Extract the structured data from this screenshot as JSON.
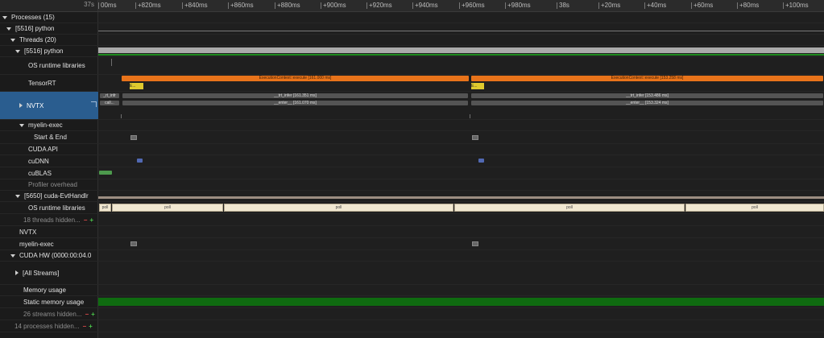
{
  "ruler": {
    "corner": "37s",
    "ticks": [
      "00ms",
      "+820ms",
      "+840ms",
      "+860ms",
      "+880ms",
      "+900ms",
      "+920ms",
      "+940ms",
      "+960ms",
      "+980ms",
      "38s",
      "+20ms",
      "+40ms",
      "+60ms",
      "+80ms",
      "+100ms"
    ]
  },
  "rows": {
    "processes": "Processes (15)",
    "python_proc": "[5516] python",
    "threads": "Threads (20)",
    "python_thread": "[5516] python",
    "os_runtime": "OS runtime libraries",
    "tensorrt": "TensorRT",
    "nvtx": "NVTX",
    "myelin_exec": "myelin-exec",
    "start_end": "Start & End",
    "cuda_api": "CUDA API",
    "cudnn": "cuDNN",
    "cublas": "cuBLAS",
    "profiler_overhead": "Profiler overhead",
    "evthandler": "[5650] cuda-EvtHandlr",
    "os_runtime_2": "OS runtime libraries",
    "threads_hidden": "18 threads hidden...",
    "nvtx_2": "NVTX",
    "myelin_exec_2": "myelin-exec",
    "cuda_hw": "CUDA HW (0000:00:04.0",
    "all_streams": "[All Streams]",
    "memory_usage": "Memory usage",
    "static_memory": "Static memory usage",
    "streams_hidden": "26 streams hidden...",
    "processes_hidden": "14 processes hidden..."
  },
  "controls": {
    "minus": "−",
    "plus": "+"
  },
  "events": {
    "exec1": "ExecutionContext::execute [161.000 ms]",
    "exec2": "ExecutionContext::execute [153.258 ms]",
    "trt1": "__trt_infer [161.351 ms]",
    "trt2": "__trt_infer [153.486 ms]",
    "enter1": "__enter__ [161.070 ms]",
    "enter2": "__enter__ [153.324 ms]",
    "left_trt": "_rt_infr",
    "left_cal": "call...",
    "poll": "poll",
    "yellow": "E..."
  },
  "colors": {
    "execute": "#e8731a",
    "nvtx_selected": "#2a5d8f",
    "static_memory": "#0f6b10"
  }
}
